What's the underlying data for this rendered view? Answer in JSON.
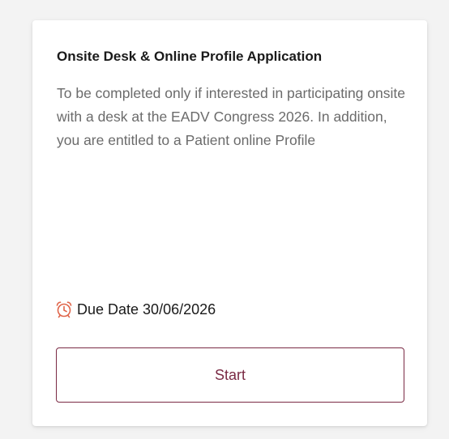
{
  "card": {
    "title": "Onsite Desk & Online Profile Application",
    "description": "To be completed only if interested in participating onsite with a desk at the EADV Congress 2026. In addition, you are entitled to a Patient online Profile",
    "due_icon": "alarm-clock-icon",
    "due_label": "Due Date 30/06/2026",
    "start_label": "Start"
  },
  "colors": {
    "accent": "#7a2a44",
    "icon": "#e0654a",
    "title": "#1a1a1a",
    "description": "#6b6b6b",
    "background": "#f3f3f3"
  }
}
